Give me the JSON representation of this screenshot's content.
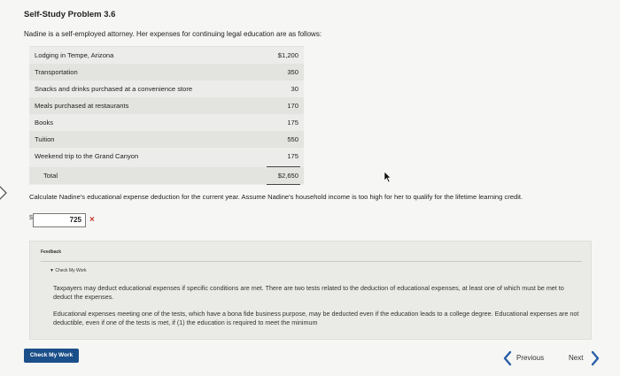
{
  "problem": {
    "title": "Self-Study Problem 3.6",
    "intro": "Nadine is a self-employed attorney. Her expenses for continuing legal education are as follows:"
  },
  "expenses": [
    {
      "label": "Lodging in Tempe, Arizona",
      "amount": "$1,200"
    },
    {
      "label": "Transportation",
      "amount": "350"
    },
    {
      "label": "Snacks and drinks purchased at a convenience store",
      "amount": "30"
    },
    {
      "label": "Meals purchased at restaurants",
      "amount": "170"
    },
    {
      "label": "Books",
      "amount": "175"
    },
    {
      "label": "Tuition",
      "amount": "550"
    },
    {
      "label": "Weekend trip to the Grand Canyon",
      "amount": "175"
    }
  ],
  "total": {
    "label": "Total",
    "amount": "$2,650"
  },
  "question": "Calculate Nadine's educational expense deduction for the current year. Assume Nadine's household income is too high for her to qualify for the lifetime learning credit.",
  "answer": {
    "currency": "$",
    "value": "725",
    "status_icon": "×"
  },
  "feedback": {
    "label": "Feedback",
    "toggle": "▼ Check My Work",
    "paragraph1": "Taxpayers may deduct educational expenses if specific conditions are met. There are two tests related to the deduction of educational expenses, at least one of which must be met to deduct the expenses.",
    "paragraph2": "Educational expenses meeting one of the tests, which have a bona fide business purpose, may be deducted even if the education leads to a college degree. Educational expenses are not deductible, even if one of the tests is met, if (1) the education is required to meet the minimum"
  },
  "nav": {
    "check_my_work": "Check My Work",
    "previous": "Previous",
    "next": "Next"
  },
  "colors": {
    "accent": "#1b4f8a",
    "error": "#c0392b",
    "nav_chevron": "#2a5ea8"
  }
}
